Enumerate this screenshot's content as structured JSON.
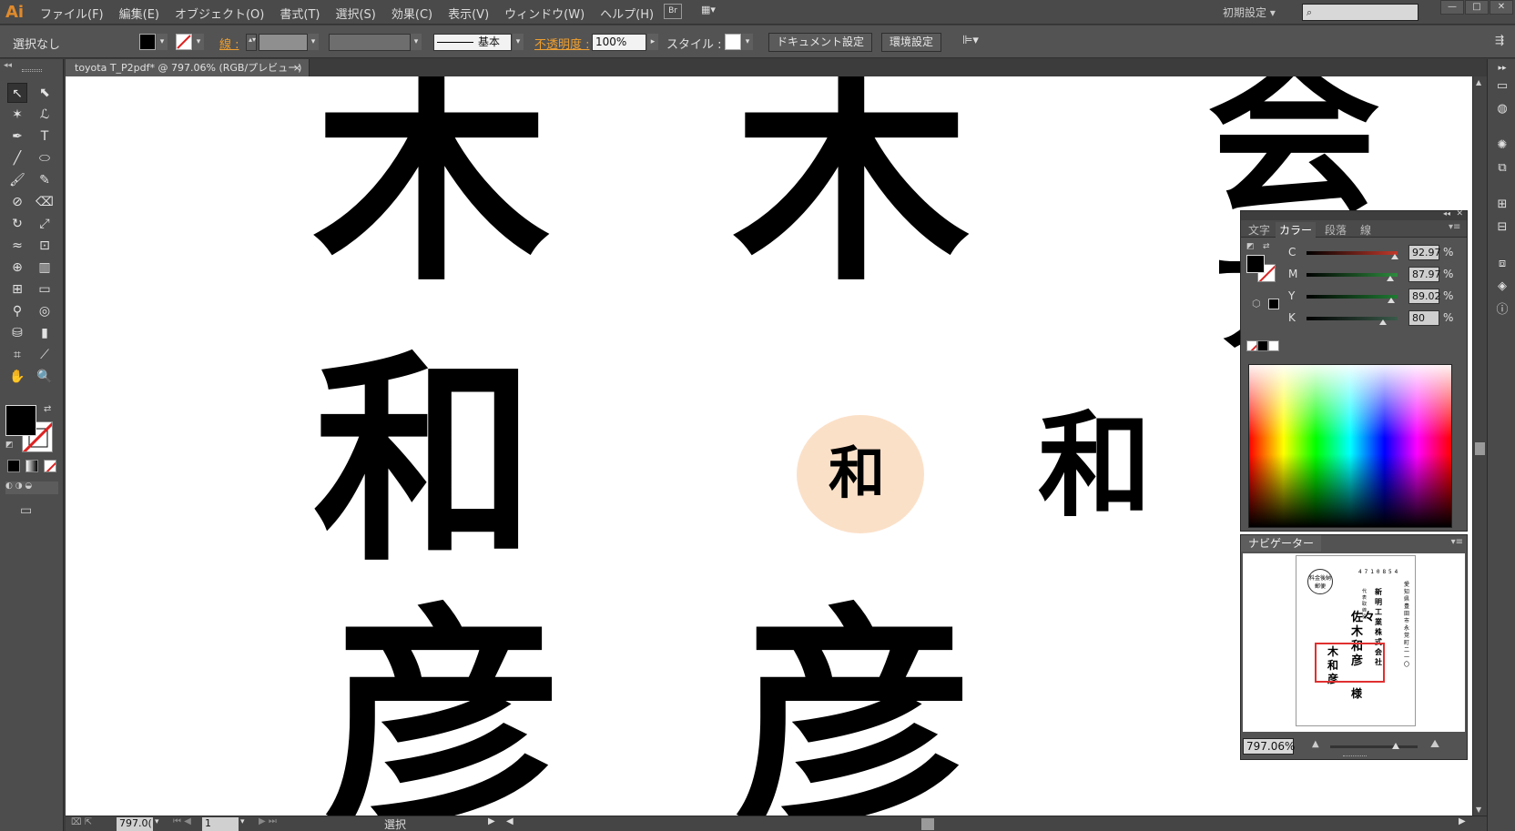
{
  "app": {
    "logo": "Ai",
    "menus": [
      "ファイル(F)",
      "編集(E)",
      "オブジェクト(O)",
      "書式(T)",
      "選択(S)",
      "効果(C)",
      "表示(V)",
      "ウィンドウ(W)",
      "ヘルプ(H)"
    ],
    "bridge_label": "Br",
    "workspace": "初期設定",
    "search_placeholder": "",
    "win_min": "—",
    "win_max": "□",
    "win_close": "✕"
  },
  "controlbar": {
    "selection": "選択なし",
    "stroke_label": "線 :",
    "stroke_profile": "基本",
    "opacity_label": "不透明度 :",
    "opacity_value": "100%",
    "style_label": "スタイル :",
    "doc_settings": "ドキュメント設定",
    "prefs": "環境設定"
  },
  "document": {
    "tab_title": "toyota T_P2pdf* @ 797.06% (RGB/プレビュー)",
    "tab_close": "×"
  },
  "canvas": {
    "glyphs": [
      {
        "char": "木"
      },
      {
        "char": "木"
      },
      {
        "char": "会"
      },
      {
        "char": "和"
      },
      {
        "char": "和"
      },
      {
        "char": "和"
      },
      {
        "char": "彦"
      },
      {
        "char": "彦"
      },
      {
        "char": "ア"
      }
    ]
  },
  "statusbar": {
    "zoom": "797.0(",
    "page": "1",
    "tool": "選択"
  },
  "colorpanel": {
    "tabs": [
      "文字",
      "カラー",
      "段落",
      "線"
    ],
    "channels": [
      {
        "label": "C",
        "value": "92.97",
        "color": "#c0392b",
        "fraction": 0.93
      },
      {
        "label": "M",
        "value": "87.97",
        "color": "#2e8b3e",
        "fraction": 0.88
      },
      {
        "label": "Y",
        "value": "89.02",
        "color": "#1f7a33",
        "fraction": 0.89
      },
      {
        "label": "K",
        "value": "80",
        "color": "#3a5a4a",
        "fraction": 0.8
      }
    ],
    "pct": "%"
  },
  "navigator": {
    "title": "ナビゲーター",
    "zoom": "797.06%",
    "preview_stamp": "料金後納 郵便",
    "preview_zip": "4710854",
    "preview_addr": "愛知県豊田市永覚町二一〇",
    "preview_company": "新明工業株式会社",
    "preview_title": "代表取締役",
    "preview_name_big": "佐々木和彦",
    "preview_name_left": "木和彦",
    "preview_sama": "様"
  }
}
